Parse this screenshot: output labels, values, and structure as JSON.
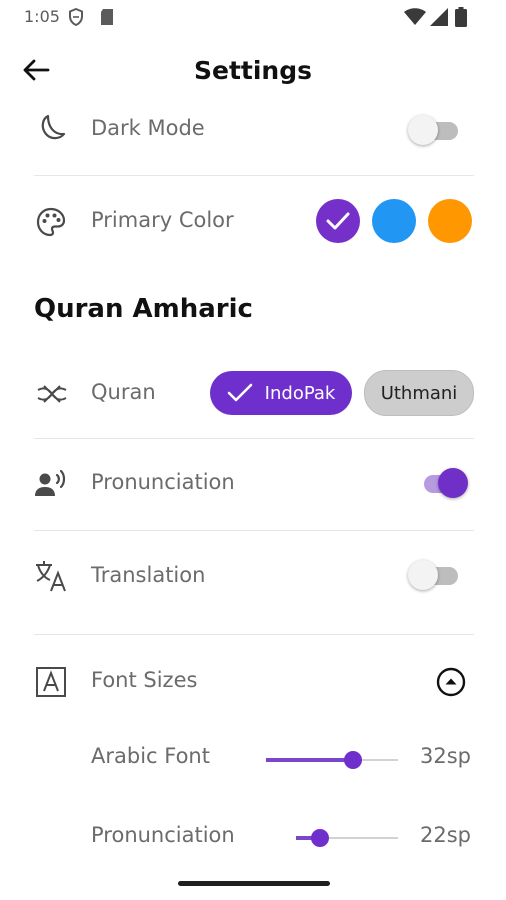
{
  "status_bar": {
    "time": "1:05"
  },
  "app_bar": {
    "title": "Settings"
  },
  "dark_mode": {
    "label": "Dark Mode",
    "enabled": false
  },
  "primary_color": {
    "label": "Primary Color",
    "options": [
      {
        "color": "#7430c9",
        "selected": true
      },
      {
        "color": "#2196f3",
        "selected": false
      },
      {
        "color": "#ff9800",
        "selected": false
      }
    ]
  },
  "section": {
    "title": "Quran Amharic"
  },
  "quran": {
    "label": "Quran",
    "options": [
      "IndoPak",
      "Uthmani"
    ],
    "selected": "IndoPak"
  },
  "pronunciation": {
    "label": "Pronunciation",
    "enabled": true
  },
  "translation": {
    "label": "Translation",
    "enabled": false
  },
  "font_sizes": {
    "label": "Font Sizes",
    "arabic": {
      "label": "Arabic Font",
      "value": "32sp",
      "fraction": 0.66
    },
    "pronunciation": {
      "label": "Pronunciation",
      "value": "22sp",
      "fraction": 0.24
    }
  },
  "colors": {
    "accent": "#6f2fcc"
  }
}
